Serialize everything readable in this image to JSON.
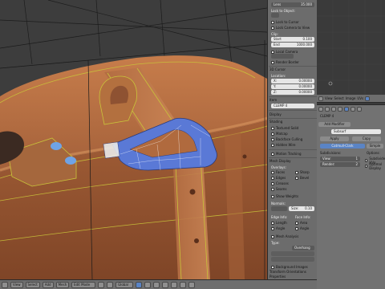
{
  "npanel": {
    "lens_label": "Lens",
    "lens_value": "35.000",
    "lock_label": "Lock to Object:",
    "lock_to_cursor": "Lock to Cursor",
    "lock_camera": "Lock Camera to View",
    "clip_label": "Clip:",
    "clip_start": "0.100",
    "clip_start_label": "Start",
    "clip_end": "1000.000",
    "clip_end_label": "End",
    "local_camera": "Local Camera",
    "render_border": "Render Border",
    "cursor_head": "3D Cursor",
    "location_label": "Location:",
    "x_label": "X:",
    "x_value": "0.00000",
    "y_label": "Y:",
    "y_value": "0.00000",
    "z_label": "Z:",
    "z_value": "0.00000",
    "item_head": "Item",
    "object_name": "CLEMP 4",
    "display_head": "Display",
    "shading_head": "Shading",
    "textured_solid": "Textured Solid",
    "matcap": "Matcap",
    "backface_culling": "Backface Culling",
    "hidden_wire": "Hidden Wire",
    "motion_tracking": "Motion Tracking",
    "mesh_display": "Mesh Display",
    "overlays_label": "Overlays:",
    "faces": "Faces",
    "edges": "Edges",
    "seams": "Seams",
    "sharp": "Sharp",
    "creases": "Creases",
    "bevel": "Bevel",
    "edge_marks": "Edge Marks",
    "face_marks": "Face Marks",
    "show_weights": "Show Weights",
    "normals_label": "Normals:",
    "size_label": "Size:",
    "size_value": "0.10",
    "edge_info": "Edge Info:",
    "face_info": "Face Info:",
    "length": "Length",
    "area": "Area",
    "angle": "Angle",
    "angle2": "Angle",
    "mesh_analysis": "Mesh Analysis",
    "type_label": "Type:",
    "overhang": "Overhang",
    "background_images": "Background Images",
    "transform_orientations": "Transform Orientations",
    "properties_head": "Properties"
  },
  "header": {
    "view": "View",
    "select": "Select",
    "add": "Add",
    "mesh": "Mesh",
    "mode": "Edit Mode",
    "shading": "Solid",
    "pivot": "Global"
  },
  "outliner": {
    "view": "View",
    "select": "Select",
    "image": "Image",
    "uvs": "UVs"
  },
  "props": {
    "object_name": "CLEMP 4",
    "add_modifier": "Add Modifier",
    "modifier_name": "Subsurf",
    "apply": "Apply",
    "copy": "Copy",
    "catmull": "Catmull-Clark",
    "simple": "Simple",
    "subdivisions": "Subdivisions:",
    "options": "Options:",
    "view_label": "View:",
    "view_value": "1",
    "render_label": "Render:",
    "render_value": "2",
    "subdivide_uvs": "Subdivide UVs",
    "optimal_display": "Optimal Display"
  },
  "colors": {
    "suitcase": "#b06a3e",
    "selection": "#5a79d6",
    "wire": "#c9c43a",
    "accent": "#5a84c5"
  }
}
